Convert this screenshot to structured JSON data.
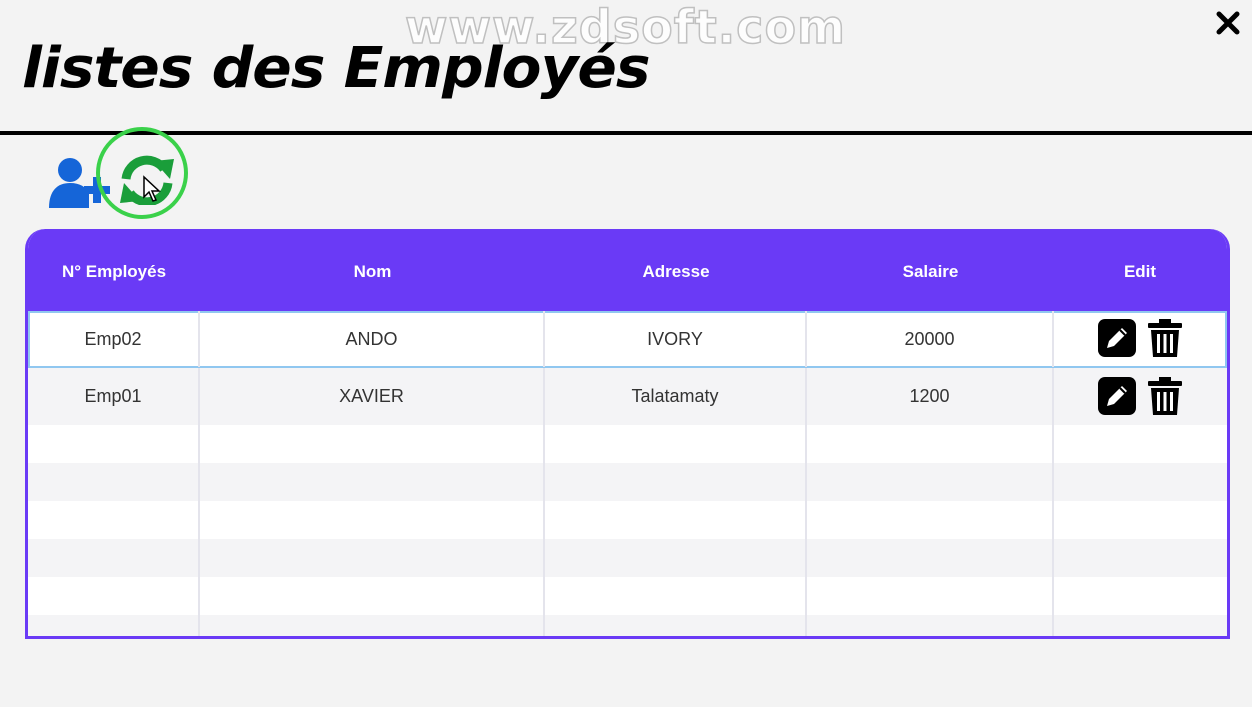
{
  "watermark": "www.zdsoft.com",
  "page": {
    "title": "listes des Employés"
  },
  "toolbar": {
    "add_icon": "add-user-icon",
    "refresh_icon": "refresh-icon"
  },
  "colors": {
    "accent": "#6a3af6",
    "add_icon": "#1565d8",
    "refresh_icon": "#1a9e3a",
    "highlight_ring": "#3ad14a"
  },
  "table": {
    "columns": [
      "N° Employés",
      "Nom",
      "Adresse",
      "Salaire",
      "Edit"
    ],
    "rows": [
      {
        "id": "Emp02",
        "nom": "ANDO",
        "adresse": "IVORY",
        "salaire": "20000"
      },
      {
        "id": "Emp01",
        "nom": "XAVIER",
        "adresse": "Talatamaty",
        "salaire": "1200"
      }
    ],
    "row_actions": [
      "edit-icon",
      "trash-icon"
    ]
  }
}
